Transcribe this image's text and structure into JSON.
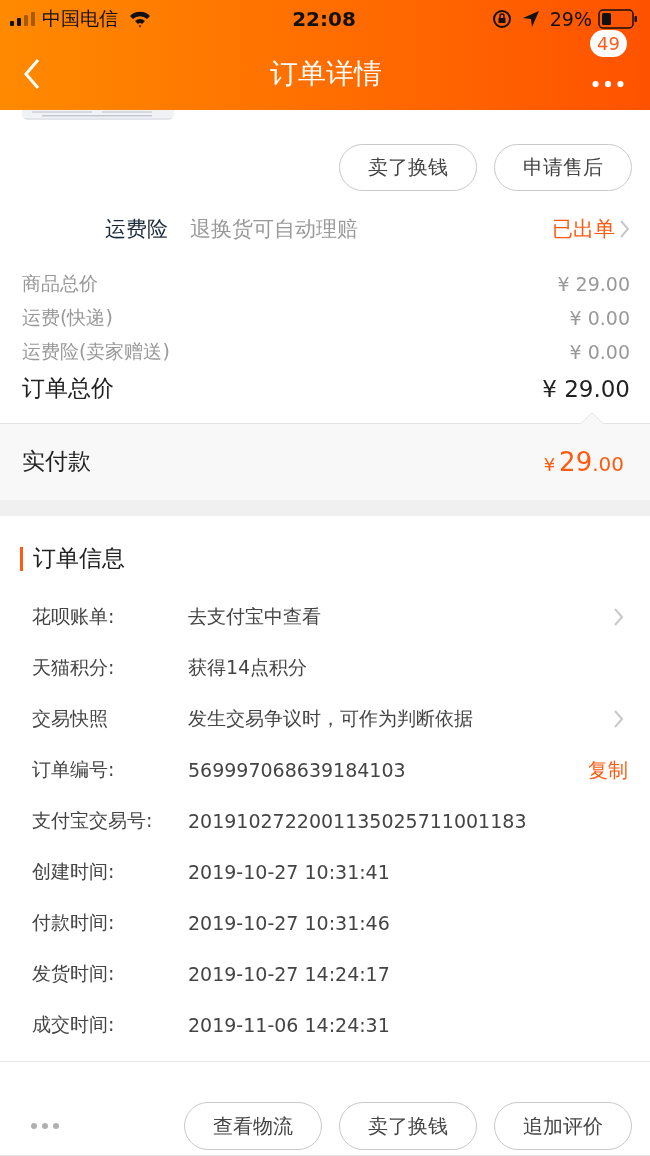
{
  "status_bar": {
    "carrier": "中国电信",
    "time": "22:08",
    "battery": "29%"
  },
  "nav": {
    "title": "订单详情",
    "badge": "49"
  },
  "header_picture": {
    "kind": "picture"
  },
  "top_buttons": [
    "卖了换钱",
    "申请售后"
  ],
  "insurance": {
    "label": "运费险",
    "description": "退换货可自动理赔",
    "status": "已出单"
  },
  "price_rows": [
    {
      "label": "商品总价",
      "value": "¥ 29.00",
      "kind": "minor"
    },
    {
      "label": "运费(快递)",
      "value": "¥ 0.00",
      "kind": "minor"
    },
    {
      "label": "运费险(卖家赠送)",
      "value": "¥ 0.00",
      "kind": "minor"
    },
    {
      "label": "订单总价",
      "value": "¥ 29.00",
      "kind": "total"
    }
  ],
  "paid": {
    "label": "实付款",
    "currency": "¥",
    "integer": "29",
    "decimal": ".00"
  },
  "order_info": {
    "title": "订单信息",
    "rows": [
      {
        "label": "花呗账单:",
        "value": "去支付宝中查看",
        "arrow": true
      },
      {
        "label": "天猫积分:",
        "value": "获得14点积分",
        "arrow": false
      },
      {
        "label": "交易快照",
        "value": "发生交易争议时，可作为判断依据",
        "arrow": true
      },
      {
        "label": "订单编号:",
        "value": "569997068639184103",
        "arrow": false,
        "action": "复制"
      },
      {
        "label": "支付宝交易号:",
        "value": "2019102722001135025711001183",
        "arrow": false
      },
      {
        "label": "创建时间:",
        "value": "2019-10-27 10:31:41",
        "arrow": false
      },
      {
        "label": "付款时间:",
        "value": "2019-10-27 10:31:46",
        "arrow": false
      },
      {
        "label": "发货时间:",
        "value": "2019-10-27 14:24:17",
        "arrow": false
      },
      {
        "label": "成交时间:",
        "value": "2019-11-06 14:24:31",
        "arrow": false
      }
    ]
  },
  "bottom_buttons": [
    "查看物流",
    "卖了换钱",
    "追加评价"
  ]
}
